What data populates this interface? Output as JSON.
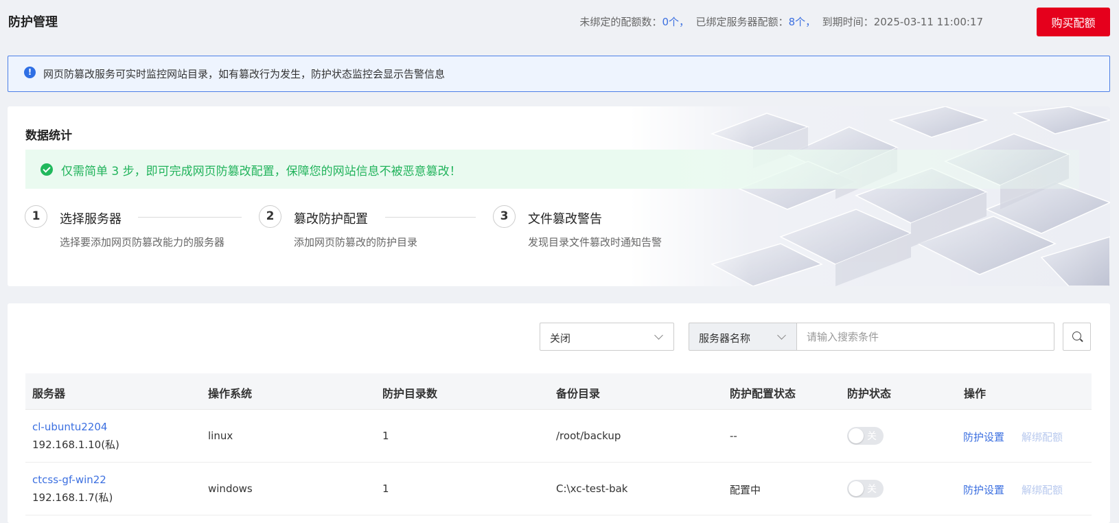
{
  "header": {
    "title": "防护管理",
    "unbound_label": "未绑定的配额数：",
    "unbound_count": "0个",
    "bound_label": "已绑定服务器配额：",
    "bound_count": "8个",
    "expiry_label": "到期时间：",
    "expiry_time": "2025-03-11 11:00:17",
    "buy_button": "购买配额",
    "sep": "，"
  },
  "notice": {
    "icon": "info-icon",
    "text": "网页防篡改服务可实时监控网站目录，如有篡改行为发生，防护状态监控会显示告警信息"
  },
  "stats": {
    "title": "数据统计",
    "tip": "仅需简单 3 步，即可完成网页防篡改配置，保障您的网站信息不被恶意篡改！",
    "steps": [
      {
        "num": "1",
        "title": "选择服务器",
        "desc": "选择要添加网页防篡改能力的服务器"
      },
      {
        "num": "2",
        "title": "篡改防护配置",
        "desc": "添加网页防篡改的防护目录"
      },
      {
        "num": "3",
        "title": "文件篡改警告",
        "desc": "发现目录文件篡改时通知告警"
      }
    ]
  },
  "filters": {
    "status_select": "关闭",
    "field_select": "服务器名称",
    "search_placeholder": "请输入搜索条件"
  },
  "table": {
    "headers": [
      "服务器",
      "操作系统",
      "防护目录数",
      "备份目录",
      "防护配置状态",
      "防护状态",
      "操作"
    ],
    "rows": [
      {
        "name": "cl-ubuntu2204",
        "ip": "192.168.1.10(私)",
        "os": "linux",
        "dirs": "1",
        "backup": "/root/backup",
        "config_status": "--",
        "toggle": "关",
        "action1": "防护设置",
        "action2": "解绑配额"
      },
      {
        "name": "ctcss-gf-win22",
        "ip": "192.168.1.7(私)",
        "os": "windows",
        "dirs": "1",
        "backup": "C:\\xc-test-bak",
        "config_status": "配置中",
        "toggle": "关",
        "action1": "防护设置",
        "action2": "解绑配额"
      }
    ]
  },
  "colors": {
    "accent": "#3b6fe0",
    "buy_button": "#e5001c",
    "success": "#21b35b"
  }
}
